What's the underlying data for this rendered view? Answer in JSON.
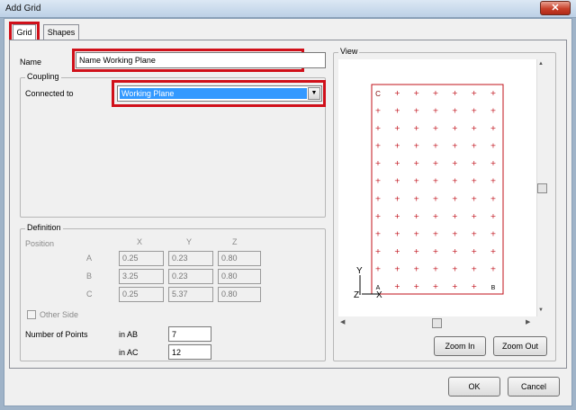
{
  "window": {
    "title": "Add Grid",
    "close_glyph": "✕"
  },
  "tabs": [
    {
      "label": "Grid"
    },
    {
      "label": "Shapes"
    }
  ],
  "name_field": {
    "label": "Name",
    "value": "Name Working Plane"
  },
  "coupling": {
    "title": "Coupling",
    "connected_label": "Connected to",
    "selected": "Working Plane"
  },
  "definition": {
    "title": "Definition",
    "position_label": "Position",
    "columns": [
      "X",
      "Y",
      "Z"
    ],
    "rows": [
      {
        "label": "A",
        "values": [
          "0.25",
          "0.23",
          "0.80"
        ]
      },
      {
        "label": "B",
        "values": [
          "3.25",
          "0.23",
          "0.80"
        ]
      },
      {
        "label": "C",
        "values": [
          "0.25",
          "5.37",
          "0.80"
        ]
      }
    ],
    "other_side": "Other Side",
    "points_label": "Number of Points",
    "in_ab_label": "in AB",
    "in_ab_value": "7",
    "in_ac_label": "in AC",
    "in_ac_value": "12"
  },
  "view": {
    "title": "View",
    "grid_cols": 7,
    "grid_rows": 12,
    "corner_labels": {
      "top_left": "C",
      "bottom_left": "A",
      "bottom_right": "B"
    },
    "axis_labels": {
      "y": "Y",
      "x": "X",
      "z": "Z"
    },
    "zoom_in": "Zoom In",
    "zoom_out": "Zoom Out"
  },
  "buttons": {
    "ok": "OK",
    "cancel": "Cancel"
  },
  "colors": {
    "grid_red": "#c0101a",
    "highlight": "#d0101a",
    "select_blue": "#3399ff"
  }
}
